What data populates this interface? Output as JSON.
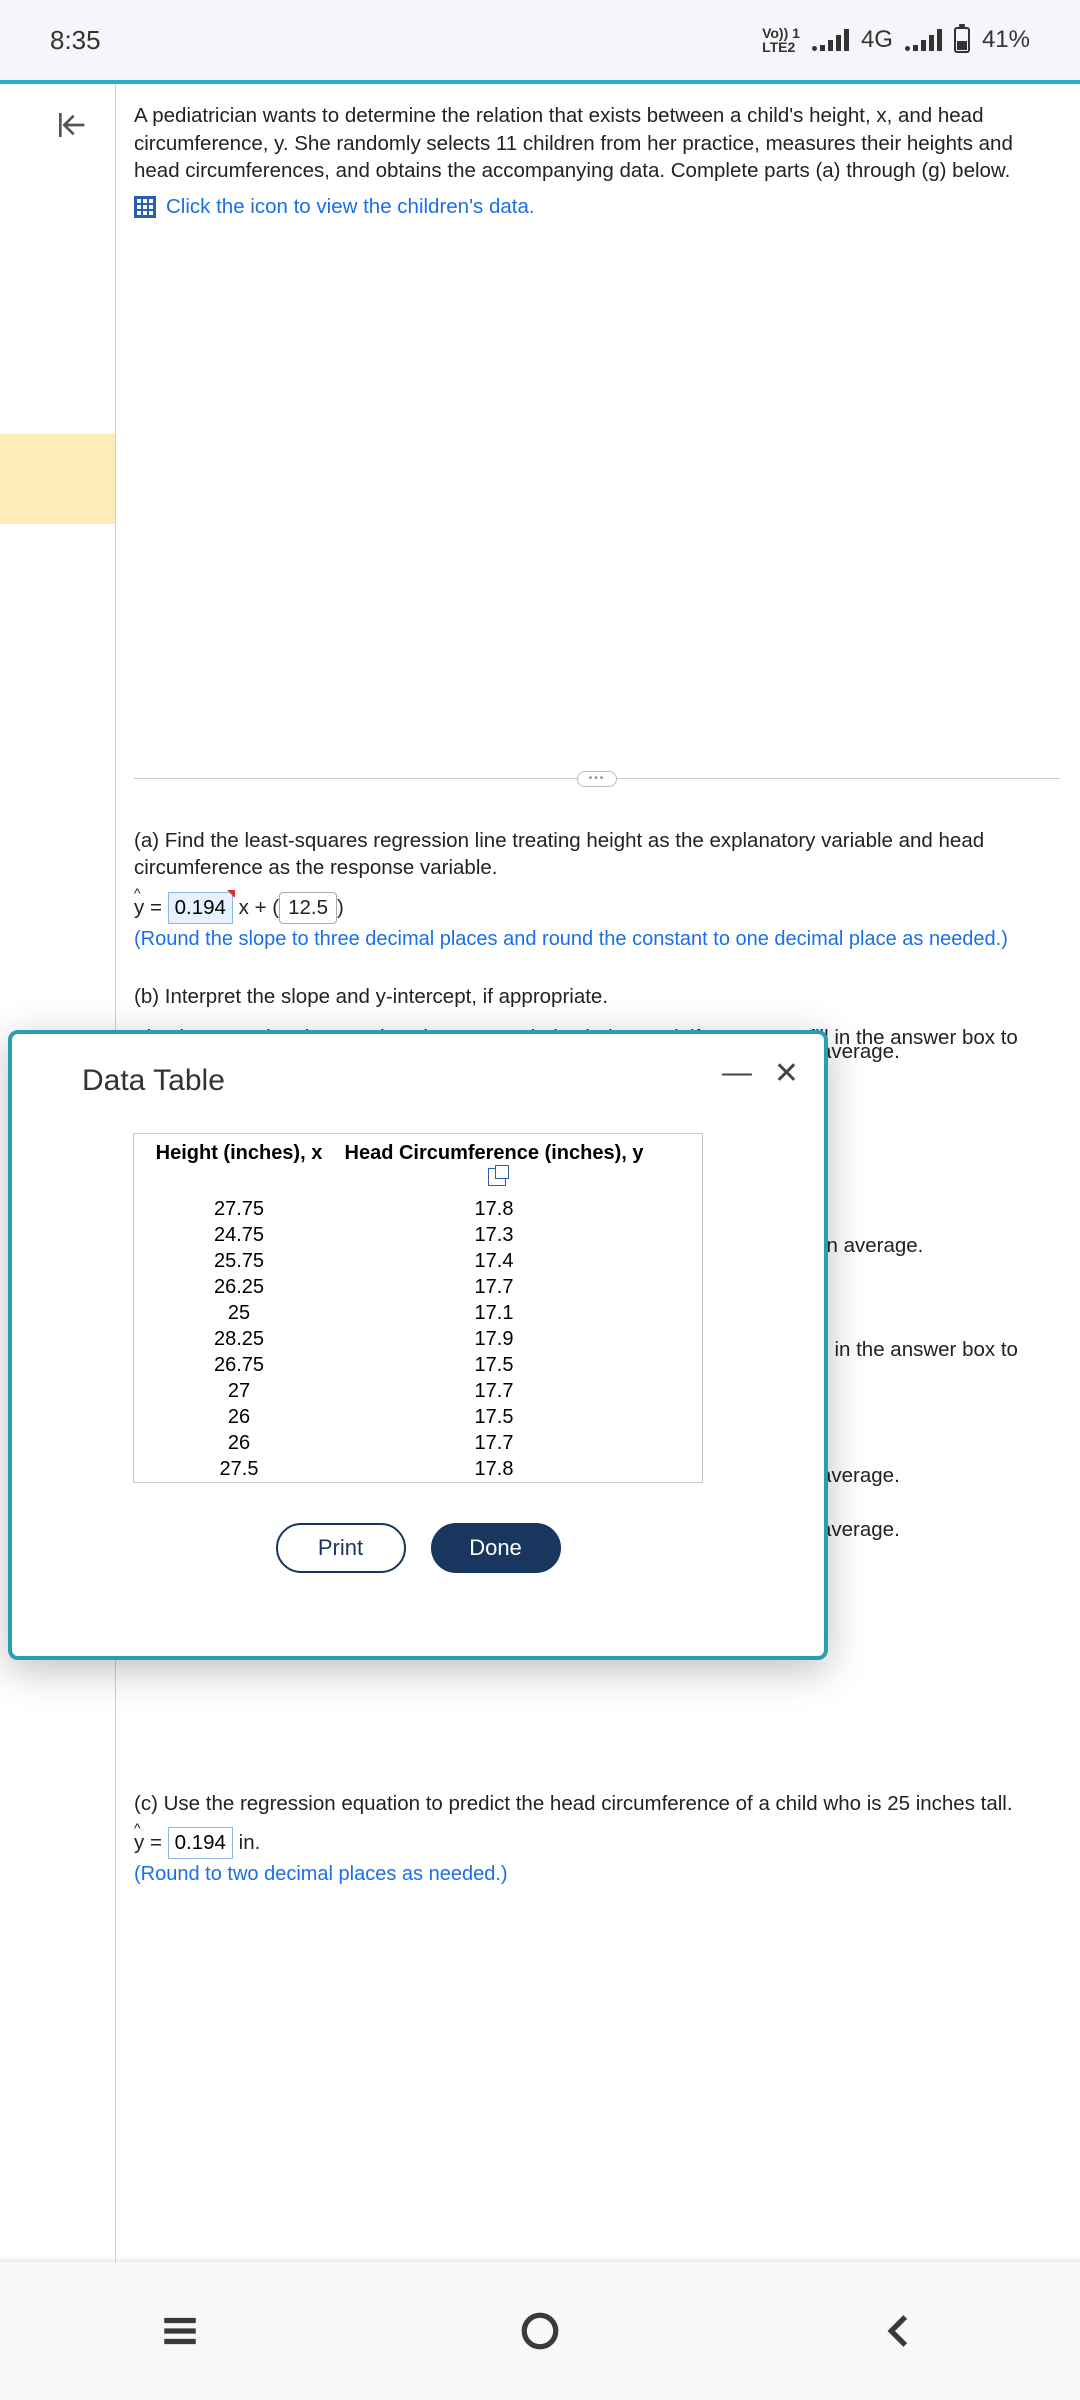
{
  "status": {
    "time": "8:35",
    "vol_line1": "Vo)) 1",
    "vol_line2": "LTE2",
    "net_label": "4G",
    "battery": "41%"
  },
  "question": {
    "intro": "A pediatrician wants to determine the relation that exists between a child's height, x, and head circumference, y. She randomly selects 11 children from her practice, measures their heights and head circumferences, and obtains the accompanying data. Complete parts (a) through (g) below.",
    "data_link": "Click the icon to view the children's data."
  },
  "part_a": {
    "prompt": "(a) Find the least-squares regression line treating height as the explanatory variable and head circumference as the response variable.",
    "eq_prefix": "y = ",
    "slope_input": "0.194",
    "mid": " x + ",
    "intercept_input": "12.5",
    "hint": "(Round the slope to three decimal places and round the constant to one decimal place as needed.)"
  },
  "part_b": {
    "prompt": "(b) Interpret the slope and y-intercept, if appropriate.",
    "sub": "First interpret the slope. Select the correct choice below and, if necessary, fill in the answer box to complete your choice."
  },
  "strays": {
    "s1": "average.",
    "s2": "., on average.",
    "s3": ", fill in the answer box to",
    "s4": "average.",
    "s5": "average."
  },
  "part_c": {
    "prompt": "(c) Use the regression equation to predict the head circumference of a child who is 25 inches tall.",
    "eq_prefix": "y = ",
    "value": "0.194",
    "unit": " in.",
    "hint": "(Round to two decimal places as needed.)"
  },
  "modal": {
    "title": "Data Table",
    "head_x": "Height (inches), x",
    "head_y": "Head Circumference (inches), y",
    "print": "Print",
    "done": "Done"
  },
  "chart_data": {
    "type": "table",
    "columns": [
      "Height (inches), x",
      "Head Circumference (inches), y"
    ],
    "rows": [
      {
        "x": "27.75",
        "y": "17.8"
      },
      {
        "x": "24.75",
        "y": "17.3"
      },
      {
        "x": "25.75",
        "y": "17.4"
      },
      {
        "x": "26.25",
        "y": "17.7"
      },
      {
        "x": "25",
        "y": "17.1"
      },
      {
        "x": "28.25",
        "y": "17.9"
      },
      {
        "x": "26.75",
        "y": "17.5"
      },
      {
        "x": "27",
        "y": "17.7"
      },
      {
        "x": "26",
        "y": "17.5"
      },
      {
        "x": "26",
        "y": "17.7"
      },
      {
        "x": "27.5",
        "y": "17.8"
      }
    ]
  }
}
